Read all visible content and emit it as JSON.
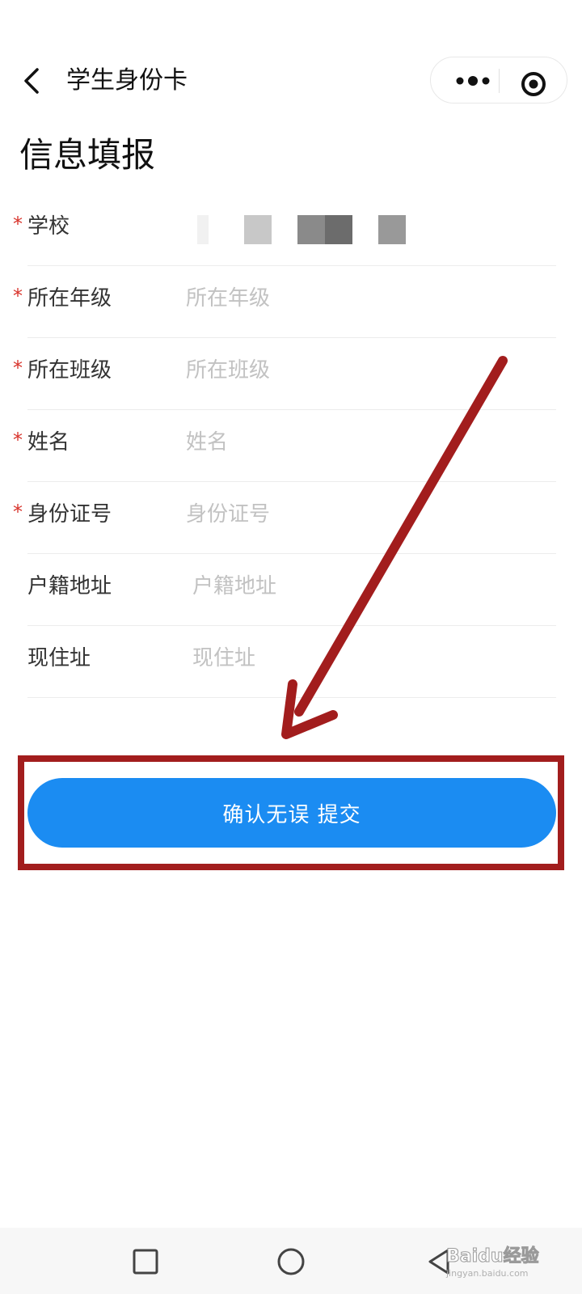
{
  "nav": {
    "title": "学生身份卡",
    "back_icon": "chevron-left-icon",
    "more_icon": "more-dots-icon",
    "close_icon": "target-close-icon"
  },
  "heading": "信息填报",
  "form": {
    "fields": [
      {
        "label": "学校",
        "required": true,
        "value": "",
        "placeholder": ""
      },
      {
        "label": "所在年级",
        "required": true,
        "value": "",
        "placeholder": "所在年级"
      },
      {
        "label": "所在班级",
        "required": true,
        "value": "",
        "placeholder": "所在班级"
      },
      {
        "label": "姓名",
        "required": true,
        "value": "",
        "placeholder": "姓名"
      },
      {
        "label": "身份证号",
        "required": true,
        "value": "",
        "placeholder": "身份证号"
      },
      {
        "label": "户籍地址",
        "required": false,
        "value": "",
        "placeholder": "户籍地址"
      },
      {
        "label": "现住址",
        "required": false,
        "value": "",
        "placeholder": "现住址"
      }
    ],
    "required_mark": "*",
    "submit_label": "确认无误 提交"
  },
  "colors": {
    "accent": "#1b8cf2",
    "required": "#d8342c",
    "annotation": "#a21d1d"
  },
  "system_nav": {
    "recents_icon": "square-icon",
    "home_icon": "circle-icon",
    "back_icon": "triangle-back-icon"
  },
  "watermark": {
    "text": "Baidu经验",
    "sub": "jingyan.baidu.com"
  }
}
